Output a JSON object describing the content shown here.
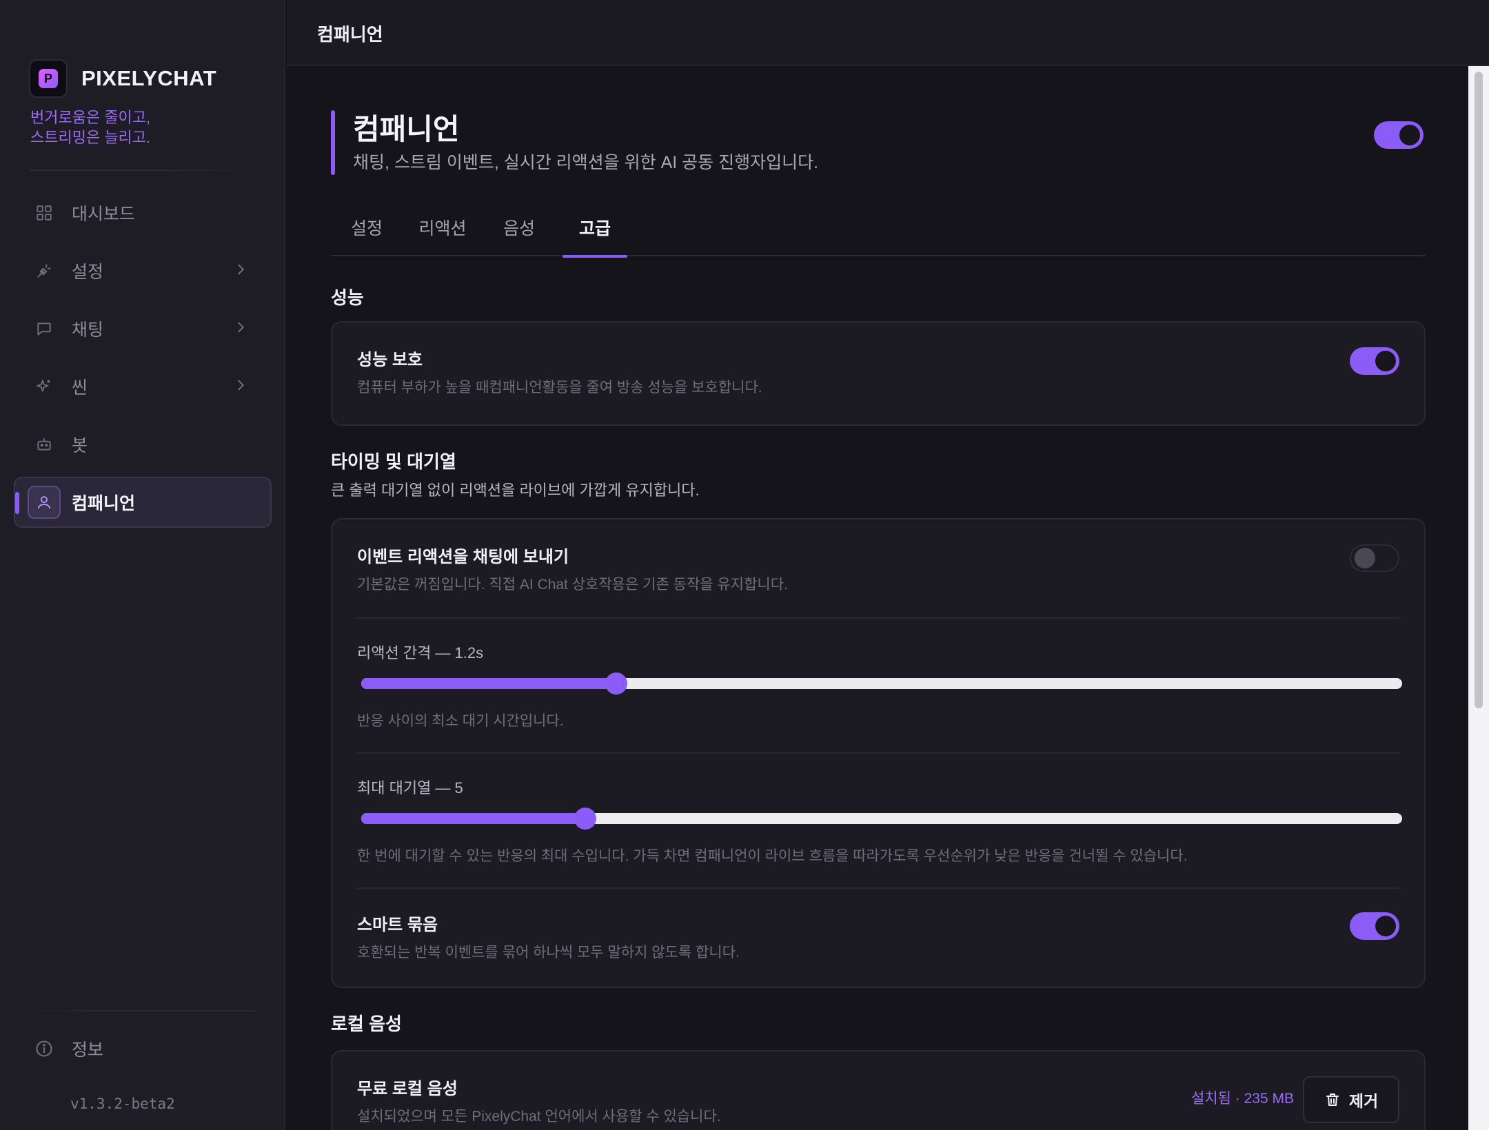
{
  "app": {
    "name": "PIXELYCHAT",
    "logo_letter": "P",
    "tagline_line1": "번거로움은 줄이고,",
    "tagline_line2": "스트리밍은 늘리고.",
    "version": "v1.3.2-beta2",
    "accent_color": "#8b5cf6"
  },
  "sidebar": {
    "items": [
      {
        "label": "대시보드",
        "icon": "grid-icon"
      },
      {
        "label": "설정",
        "icon": "plug-icon"
      },
      {
        "label": "채팅",
        "icon": "chat-bubble-icon"
      },
      {
        "label": "씬",
        "icon": "sparkles-icon"
      },
      {
        "label": "봇",
        "icon": "robot-icon"
      },
      {
        "label": "컴패니언",
        "icon": "user-icon",
        "active": true
      }
    ],
    "info_label": "정보"
  },
  "topbar": {
    "title": "컴패니언"
  },
  "page": {
    "title": "컴패니언",
    "subtitle": "채팅, 스트림 이벤트, 실시간 리액션을 위한 AI 공동 진행자입니다.",
    "enabled": true
  },
  "tabs": [
    {
      "label": "설정"
    },
    {
      "label": "리액션"
    },
    {
      "label": "음성"
    },
    {
      "label": "고급",
      "active": true
    }
  ],
  "performance": {
    "section_title": "성능",
    "protect_title": "성능 보호",
    "protect_desc": "컴퓨터 부하가 높을 때컴패니언활동을 줄여 방송 성능을 보호합니다.",
    "protect_enabled": true
  },
  "timing": {
    "section_title": "타이밍 및 대기열",
    "section_sub": "큰 출력 대기열 없이 리액션을 라이브에 가깝게 유지합니다.",
    "send_title": "이벤트 리액션을 채팅에 보내기",
    "send_desc": "기본값은 꺼짐입니다. 직접 AI Chat 상호작용은 기존 동작을 유지합니다.",
    "send_enabled": false,
    "interval_label": "리액션 간격 — 1.2s",
    "interval_fraction": 0.245,
    "interval_desc": "반응 사이의 최소 대기 시간입니다.",
    "queue_label": "최대 대기열 — 5",
    "queue_fraction": 0.215,
    "queue_desc": "한 번에 대기할 수 있는 반응의 최대 수입니다. 가득 차면 컴패니언이 라이브 흐름을 따라가도록 우선순위가 낮은 반응을 건너뛸 수 있습니다.",
    "smart_title": "스마트 묶음",
    "smart_desc": "호환되는 반복 이벤트를 묶어 하나씩 모두 말하지 않도록 합니다.",
    "smart_enabled": true
  },
  "local_voice": {
    "section_title": "로컬 음성",
    "title": "무료 로컬 음성",
    "desc": "설치되었으며 모든 PixelyChat 언어에서 사용할 수 있습니다.",
    "status": "설치됨 · 235 MB",
    "remove_label": "제거"
  }
}
